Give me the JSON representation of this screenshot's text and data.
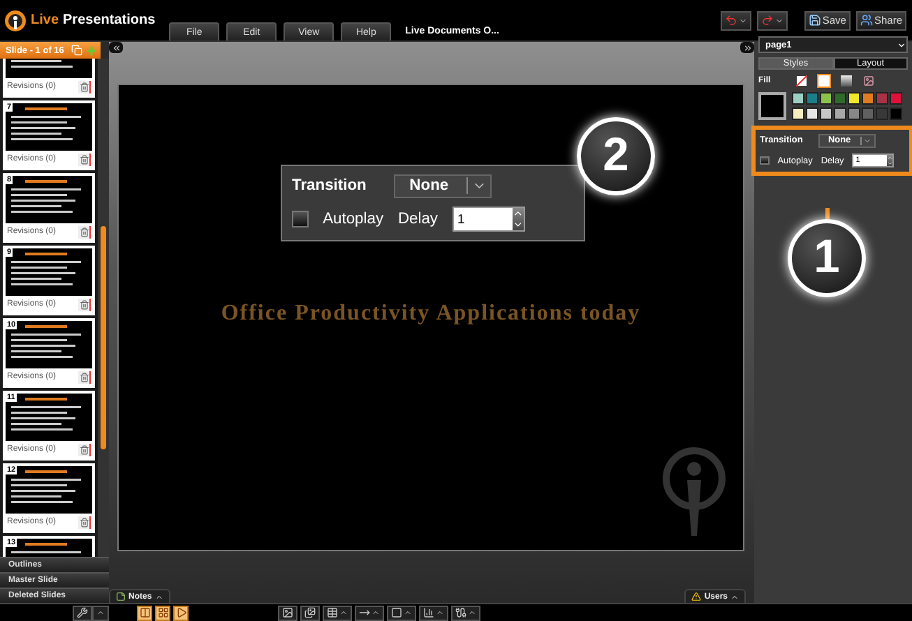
{
  "app": {
    "brand_first": "Live",
    "brand_second": "Presentations"
  },
  "menu": [
    "File",
    "Edit",
    "View",
    "Help"
  ],
  "document_title": "Live Documents O...",
  "toolbar_buttons": [
    {
      "kind": "save",
      "label": "Save"
    },
    {
      "kind": "share",
      "label": "Share"
    }
  ],
  "slide_panel": {
    "header": "Slide - 1 of 16",
    "slides": [
      {
        "revisions": "Revisions (0)"
      },
      {
        "number": "7",
        "revisions": "Revisions (0)"
      },
      {
        "number": "8",
        "revisions": "Revisions (0)"
      },
      {
        "number": "9",
        "revisions": "Revisions (0)"
      },
      {
        "number": "10",
        "revisions": "Revisions (0)"
      },
      {
        "number": "11",
        "revisions": "Revisions (0)"
      },
      {
        "number": "12",
        "revisions": "Revisions (0)"
      },
      {
        "number": "13"
      }
    ],
    "sections": [
      "Outlines",
      "Master Slide",
      "Deleted Slides"
    ]
  },
  "slide": {
    "title": "Office Productivity Applications today"
  },
  "zoomed_transition": {
    "callout": "2",
    "label": "Transition",
    "value": "None",
    "autoplay_label": "Autoplay",
    "autoplay": false,
    "delay_label": "Delay",
    "delay": "1"
  },
  "bottom_tabs": [
    {
      "kind": "notes",
      "label": "Notes"
    },
    {
      "kind": "users",
      "label": "Users"
    }
  ],
  "right_panel": {
    "page": "page1",
    "tabs": [
      {
        "label": "Styles",
        "selected": true
      },
      {
        "label": "Layout",
        "selected": false
      }
    ],
    "fill_label": "Fill",
    "fill_types": [
      {
        "kind": "none",
        "selected": false
      },
      {
        "kind": "solid",
        "selected": true
      },
      {
        "kind": "gradient",
        "selected": false
      },
      {
        "kind": "image",
        "selected": false
      }
    ],
    "fill": {
      "color": "#000000"
    },
    "palette": [
      {
        "color": "#9ccfc4"
      },
      {
        "color": "#1a7f8a"
      },
      {
        "color": "#8bc34a"
      },
      {
        "color": "#2e6b2a"
      },
      {
        "color": "#f0e82a"
      },
      {
        "color": "#e07b20"
      },
      {
        "color": "#a83246"
      },
      {
        "color": "#e0103a"
      },
      {
        "color": "#f5ecc0"
      },
      {
        "color": "#e6e6e6"
      },
      {
        "color": "#c8c8c8"
      },
      {
        "color": "#a8a8a8"
      },
      {
        "color": "#888888"
      },
      {
        "color": "#606060"
      },
      {
        "color": "#383838"
      },
      {
        "color": "#000000"
      }
    ],
    "transition": {
      "callout": "1",
      "label": "Transition",
      "value": "None",
      "autoplay_label": "Autoplay",
      "autoplay": false,
      "delay_label": "Delay",
      "delay": "1"
    }
  }
}
